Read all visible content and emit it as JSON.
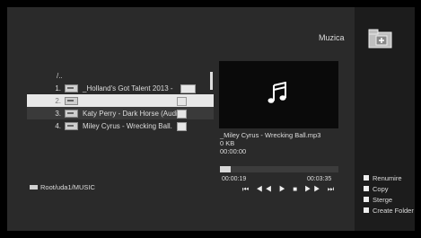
{
  "header": {
    "title": "Muzica",
    "folder_icon": "folder-add-icon"
  },
  "file_list": {
    "parent_dir": "/..",
    "items": [
      {
        "num": "1.",
        "label": "_Holland's Got Talent 2013 -",
        "state": "normal"
      },
      {
        "num": "2.",
        "label": "",
        "state": "selected"
      },
      {
        "num": "3.",
        "label": "Katy Perry - Dark Horse (Audi",
        "state": "dimmed"
      },
      {
        "num": "4.",
        "label": "Miley Cyrus - Wrecking Ball.",
        "state": "normal"
      }
    ]
  },
  "preview": {
    "icon": "music-note-icon"
  },
  "track": {
    "filename": "_Miley Cyrus - Wrecking Ball.mp3",
    "size": "0 KB",
    "duration": "00:00:00"
  },
  "playback": {
    "elapsed": "00:00:19",
    "total": "00:03:35",
    "progress": 0.09,
    "controls": "⏮ ◀◀ ▶ ■ ▶▶ ⏭"
  },
  "path": "Root/uda1/MUSIC",
  "menu": {
    "items": [
      "Renumire",
      "Copy",
      "Sterge",
      "Create Folder"
    ]
  },
  "colors": {
    "background": "#2a2a2a",
    "panel": "#1c1c1c",
    "selected_row": "#e8e8e8"
  }
}
